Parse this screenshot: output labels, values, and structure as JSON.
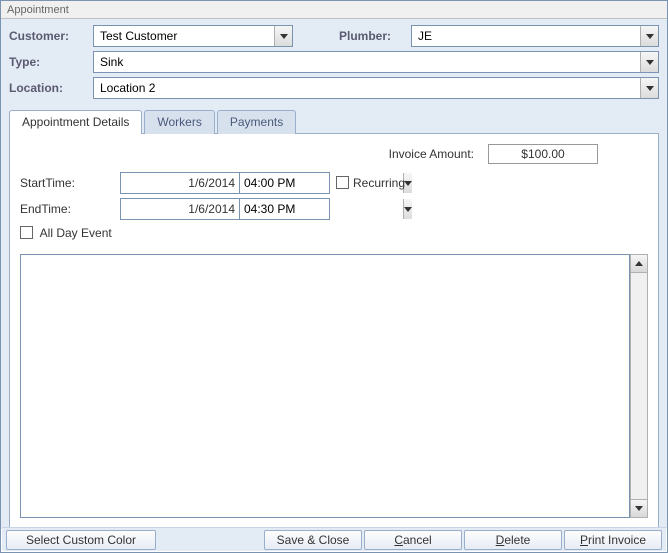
{
  "window": {
    "title": "Appointment"
  },
  "header": {
    "customer_label": "Customer:",
    "customer_value": "Test Customer",
    "plumber_label": "Plumber:",
    "plumber_value": "JE",
    "type_label": "Type:",
    "type_value": "Sink",
    "location_label": "Location:",
    "location_value": "Location 2"
  },
  "tabs": {
    "appointment_details": "Appointment Details",
    "workers": "Workers",
    "payments": "Payments",
    "active": "appointment_details"
  },
  "details": {
    "invoice_label": "Invoice Amount:",
    "invoice_value": "$100.00",
    "start_label": "StartTime:",
    "start_date": "1/6/2014",
    "start_time": "04:00 PM",
    "end_label": "EndTime:",
    "end_date": "1/6/2014",
    "end_time": "04:30 PM",
    "recurring_label": "Recurring",
    "recurring_checked": false,
    "allday_label": "All Day Event",
    "allday_checked": false,
    "notes": ""
  },
  "buttons": {
    "select_color": "Select Custom Color",
    "save_close": "Save & Close",
    "cancel": "Cancel",
    "delete": "Delete",
    "print_invoice": "Print Invoice"
  }
}
